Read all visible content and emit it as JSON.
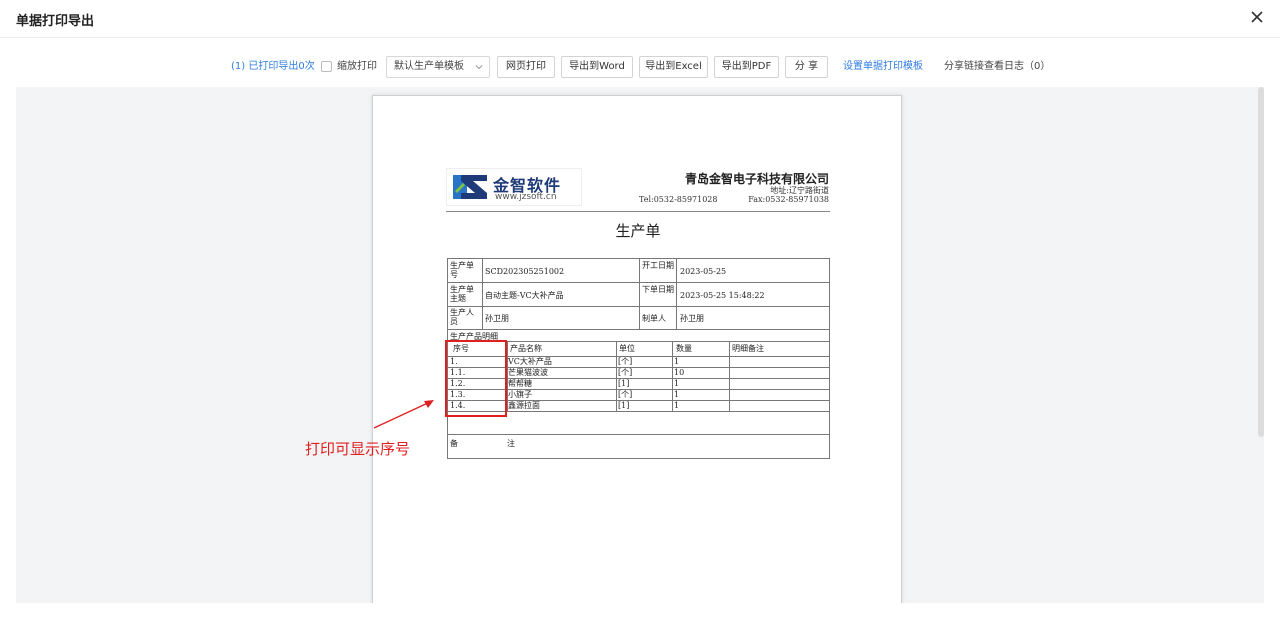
{
  "header": {
    "title": "单据打印导出"
  },
  "toolbar": {
    "print_count_label": "(1)  已打印导出0次",
    "scale_print_label": "缩放打印",
    "template_select_value": "默认生产单模板",
    "web_print_label": "网页打印",
    "export_word_label": "导出到Word",
    "export_excel_label": "导出到Excel",
    "export_pdf_label": "导出到PDF",
    "share_label": "分 享",
    "set_template_label": "设置单据打印模板",
    "share_log_label": "分享链接查看日志（0）"
  },
  "document": {
    "logo_brand": "金智软件",
    "logo_site": "www.jzsoft.cn",
    "company_name": "青岛金智电子科技有限公司",
    "address": "地址:辽宁路街道",
    "tel": "Tel:0532-85971028",
    "fax": "Fax:0532-85971038",
    "title": "生产单",
    "fields": {
      "order_no_label": "生产单号",
      "order_no_value": "SCD202305251002",
      "start_date_label": "开工日期",
      "start_date_value": "2023-05-25",
      "subject_label": "生产单主题",
      "subject_value": "自动主题-VC大补产品",
      "order_date_label": "下单日期",
      "order_date_value": "2023-05-25 15:48:22",
      "producer_label": "生产人员",
      "producer_value": "孙卫朋",
      "maker_label": "制单人",
      "maker_value": "孙卫朋"
    },
    "detail_section_label": "生产产品明细",
    "detail_headers": [
      "序号",
      "产品名称",
      "单位",
      "数量",
      "明细备注"
    ],
    "detail_rows": [
      [
        "1.",
        "VC大补产品",
        "[个]",
        "1",
        ""
      ],
      [
        "1.1.",
        "芒果猫波波",
        "[个]",
        "10",
        ""
      ],
      [
        "1.2.",
        "帮帮糖",
        "[1]",
        "1",
        ""
      ],
      [
        "1.3.",
        "小旗子",
        "[个]",
        "1",
        ""
      ],
      [
        "1.4.",
        "鑫源拉面",
        "[1]",
        "1",
        ""
      ]
    ],
    "remark_label_1": "备",
    "remark_label_2": "注"
  },
  "annotation": {
    "text": "打印可显示序号",
    "color": "#e02020"
  },
  "colors": {
    "link": "#2f7ce0",
    "annotation": "#e02020"
  }
}
